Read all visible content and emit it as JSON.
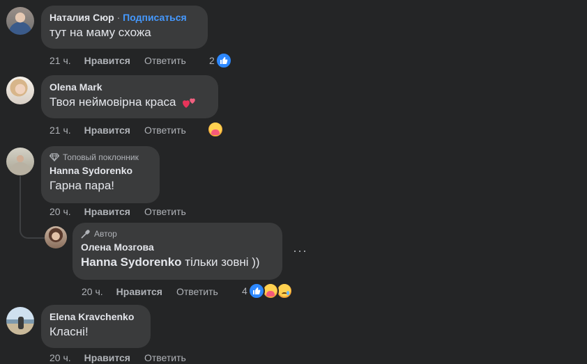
{
  "comments": [
    {
      "author": "Наталия Сюр",
      "separator": "·",
      "follow_label": "Подписаться",
      "text": "тут на маму схожа",
      "time": "21 ч.",
      "like_label": "Нравится",
      "reply_label": "Ответить",
      "reaction_count": "2",
      "reactions": [
        "like"
      ]
    },
    {
      "author": "Olena Mark",
      "text": "Твоя неймовірна краса",
      "emoji": "two-hearts",
      "time": "21 ч.",
      "like_label": "Нравится",
      "reply_label": "Ответить",
      "reactions": [
        "care"
      ]
    },
    {
      "badge": "Топовый поклонник",
      "badge_icon": "diamond-icon",
      "author": "Hanna Sydorenko",
      "text": "Гарна пара!",
      "time": "20 ч.",
      "like_label": "Нравится",
      "reply_label": "Ответить"
    },
    {
      "badge": "Автор",
      "badge_icon": "microphone-icon",
      "author": "Олена Мозгова",
      "mention": "Hanna Sydorenko",
      "text": "тільки зовні ))",
      "time": "20 ч.",
      "like_label": "Нравится",
      "reply_label": "Ответить",
      "reaction_count": "4",
      "reactions": [
        "like",
        "care",
        "sad"
      ],
      "more_label": "···"
    },
    {
      "author": "Elena Kravchenko",
      "text": "Класні!",
      "time": "20 ч.",
      "like_label": "Нравится",
      "reply_label": "Ответить"
    }
  ],
  "colors": {
    "background": "#242526",
    "bubble": "#3a3b3c",
    "link": "#4599ff",
    "like_blue": "#2d88ff"
  }
}
